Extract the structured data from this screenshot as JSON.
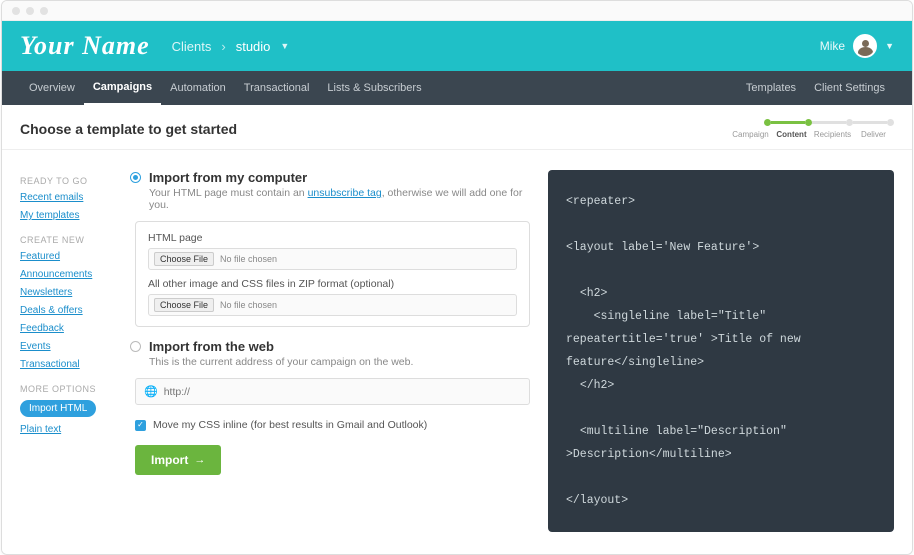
{
  "header": {
    "logo": "Your Name",
    "breadcrumb_root": "Clients",
    "breadcrumb_chev": "›",
    "breadcrumb_current": "studio",
    "user_name": "Mike"
  },
  "nav": {
    "overview": "Overview",
    "campaigns": "Campaigns",
    "automation": "Automation",
    "transactional": "Transactional",
    "lists": "Lists & Subscribers",
    "templates": "Templates",
    "client_settings": "Client Settings"
  },
  "title": "Choose a template to get started",
  "steps": {
    "campaign": "Campaign",
    "content": "Content",
    "recipients": "Recipients",
    "deliver": "Deliver"
  },
  "sidebar": {
    "h_ready": "READY TO GO",
    "recent_emails": "Recent emails",
    "my_templates": "My templates",
    "h_create": "CREATE NEW",
    "featured": "Featured",
    "announcements": "Announcements",
    "newsletters": "Newsletters",
    "deals": "Deals & offers",
    "feedback": "Feedback",
    "events": "Events",
    "transactional": "Transactional",
    "h_more": "MORE OPTIONS",
    "import_html": "Import HTML",
    "plain_text": "Plain text"
  },
  "form": {
    "import_computer_title": "Import from my computer",
    "import_computer_desc_pre": "Your HTML page must contain an ",
    "import_computer_desc_link": "unsubscribe tag",
    "import_computer_desc_post": ", otherwise we will add one for you.",
    "html_page_label": "HTML page",
    "zip_label": "All other image and CSS files in ZIP format (optional)",
    "choose_file": "Choose File",
    "no_file": "No file chosen",
    "import_web_title": "Import from the web",
    "import_web_desc": "This is the current address of your campaign on the web.",
    "url_placeholder": "http://",
    "move_css": "Move my CSS inline (for best results in Gmail and Outlook)",
    "import_btn": "Import"
  },
  "code_block": "<repeater>\n\n<layout label='New Feature'>\n\n  <h2>\n    <singleline label=\"Title\" repeatertitle='true' >Title of new feature</singleline>\n  </h2>\n\n  <multiline label=\"Description\" >Description</multiline>\n\n</layout>"
}
